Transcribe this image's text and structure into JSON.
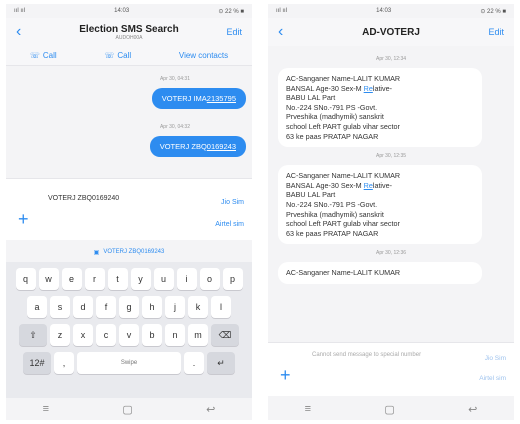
{
  "left": {
    "status_time": "14:03",
    "status_right": "⊙ 22 % ■",
    "status_left": "ııl ııl",
    "title": "Election SMS Search",
    "subtitle": "AUDOH00A",
    "edit_label": "Edit",
    "actions": {
      "call1": "Call",
      "call2": "Call",
      "view_contacts": "View contacts"
    },
    "messages": [
      {
        "time": "Apr 30, 04:31",
        "prefix": "VOTERJ IMA",
        "num": "2135795"
      },
      {
        "time": "Apr 30, 04:32",
        "prefix": "VOTERJ ZBQ",
        "num": "0169243"
      }
    ],
    "compose_text": "VOTERJ ZBQ0169240",
    "sim1": "Jio Sim",
    "sim2": "Airtel sim",
    "suggestion": "VOTERJ ZBQ0169243",
    "keyboard": {
      "row1": [
        "q",
        "w",
        "e",
        "r",
        "t",
        "y",
        "u",
        "i",
        "o",
        "p"
      ],
      "row2": [
        "a",
        "s",
        "d",
        "f",
        "g",
        "h",
        "j",
        "k",
        "l"
      ],
      "row3": [
        "z",
        "x",
        "c",
        "v",
        "b",
        "n",
        "m"
      ],
      "shift": "⇧",
      "backspace": "⌫",
      "num_key": "12#",
      "comma": ",",
      "space": "Swipe",
      "period": ".",
      "enter": "↵"
    },
    "nav": {
      "menu": "≡",
      "home": "▢",
      "back": "↩"
    }
  },
  "right": {
    "status_time": "14:03",
    "status_right": "⊙ 22 % ■",
    "status_left": "ııl ııl",
    "title": "AD-VOTERJ",
    "edit_label": "Edit",
    "messages": [
      {
        "time": "Apr 30, 12:34",
        "line1": "AC-Sanganer Name-LALIT KUMAR",
        "line2a": "BANSAL Age-30 Sex-M ",
        "rel": "Re",
        "line2b": "lative-",
        "line3": "BABU LAL Part",
        "line4": "No.-224 SNo.-791 PS -Govt.",
        "line5": "Prveshika (madhymik) sanskrit",
        "line6": "school Left PART gulab vihar sector",
        "line7": "63 ke paas PRATAP NAGAR"
      },
      {
        "time": "Apr 30, 12:35",
        "line1": "AC-Sanganer Name-LALIT KUMAR",
        "line2a": "BANSAL Age-30 Sex-M ",
        "rel": "Re",
        "line2b": "lative-",
        "line3": "BABU LAL Part",
        "line4": "No.-224 SNo.-791 PS -Govt.",
        "line5": "Prveshika (madhymik) sanskrit",
        "line6": "school Left PART gulab vihar sector",
        "line7": "63 ke paas PRATAP NAGAR"
      },
      {
        "time": "Apr 30, 12:36",
        "line1": "AC-Sanganer Name-LALIT KUMAR"
      }
    ],
    "placeholder": "Cannot send message to special number",
    "sim1": "Jio Sim",
    "sim2": "Airtel sim",
    "nav": {
      "menu": "≡",
      "home": "▢",
      "back": "↩"
    }
  },
  "colors": {
    "accent": "#2d8cf0",
    "bubble_out": "#2d8cf0",
    "bubble_in": "#ffffff"
  }
}
